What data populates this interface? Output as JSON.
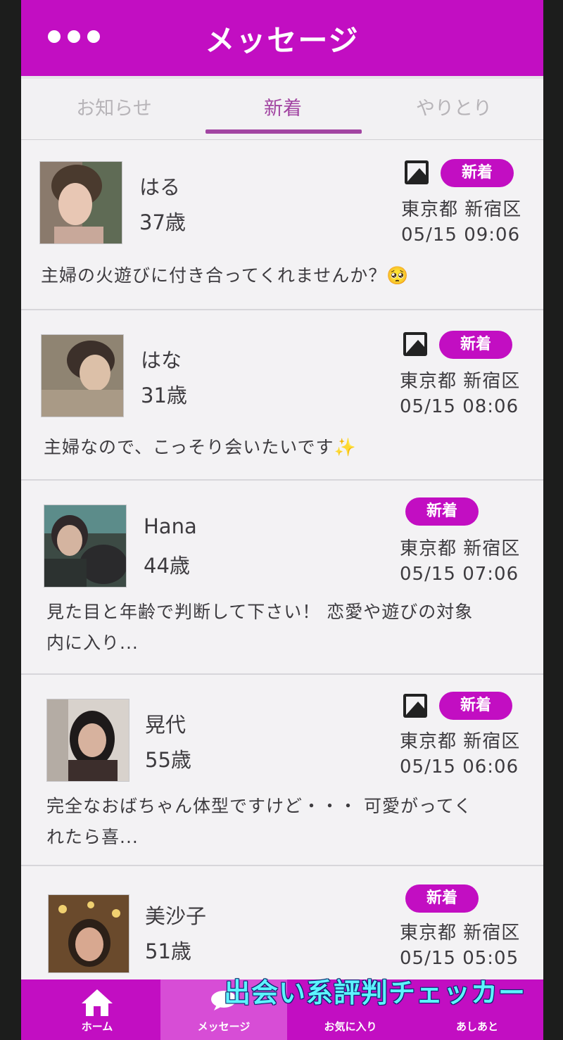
{
  "header": {
    "title": "メッセージ"
  },
  "tabs": [
    {
      "label": "お知らせ",
      "active": false
    },
    {
      "label": "新着",
      "active": true
    },
    {
      "label": "やりとり",
      "active": false
    }
  ],
  "messages": [
    {
      "name": "はる",
      "age": "37歳",
      "badge": "新着",
      "has_photo": true,
      "location": "東京都 新宿区",
      "time": "05/15 09:06",
      "text_lines": [
        "主婦の火遊びに付き合ってくれませんか？🥺"
      ]
    },
    {
      "name": "はな",
      "age": "31歳",
      "badge": "新着",
      "has_photo": true,
      "location": "東京都 新宿区",
      "time": "05/15 08:06",
      "text_lines": [
        "主婦なので、こっそり会いたいです✨"
      ]
    },
    {
      "name": "Hana",
      "age": "44歳",
      "badge": "新着",
      "has_photo": false,
      "location": "東京都 新宿区",
      "time": "05/15 07:06",
      "text_lines": [
        "見た目と年齢で判断して下さい！ 恋愛や遊びの対象",
        "内に入り..."
      ]
    },
    {
      "name": "晃代",
      "age": "55歳",
      "badge": "新着",
      "has_photo": true,
      "location": "東京都 新宿区",
      "time": "05/15 06:06",
      "text_lines": [
        "完全なおばちゃん体型ですけど・・・ 可愛がってく",
        "れたら喜..."
      ]
    },
    {
      "name": "美沙子",
      "age": "51歳",
      "badge": "新着",
      "has_photo": false,
      "location": "東京都 新宿区",
      "time": "05/15 05:05",
      "text_lines": []
    }
  ],
  "bottom_nav": [
    {
      "label": "ホーム",
      "icon": "home-icon"
    },
    {
      "label": "メッセージ",
      "icon": "message-icon"
    },
    {
      "label": "お気に入り",
      "icon": "favorite-icon"
    },
    {
      "label": "あしあと",
      "icon": "footprint-icon"
    }
  ],
  "watermark": "出会い系評判チェッカー",
  "colors": {
    "accent": "#c20ec2",
    "tab_active": "#a245a2",
    "background": "#e6e5e8"
  }
}
